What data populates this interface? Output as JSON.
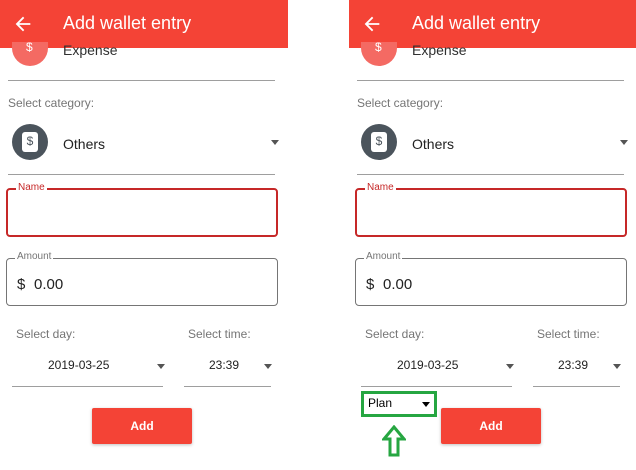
{
  "app_bar": {
    "title": "Add wallet entry"
  },
  "entry_type": {
    "value": "Expense",
    "icon_glyph": "$"
  },
  "category": {
    "section_label": "Select category:",
    "value": "Others",
    "icon_glyph": "$"
  },
  "name_field": {
    "label": "Name",
    "value": ""
  },
  "amount_field": {
    "label": "Amount",
    "currency": "$",
    "value": "0.00"
  },
  "day_picker": {
    "label": "Select day:",
    "value": "2019-03-25"
  },
  "time_picker": {
    "label": "Select time:",
    "value": "23:39"
  },
  "add_button": {
    "label": "Add"
  },
  "plan_select": {
    "selected": "Plan"
  },
  "colors": {
    "accent": "#f44336",
    "error": "#c62828",
    "highlight": "#26a641",
    "category_icon": "#4b545c"
  },
  "icons": [
    "arrow-left-icon",
    "dollar-icon",
    "chevron-down-icon",
    "arrow-up-icon"
  ]
}
